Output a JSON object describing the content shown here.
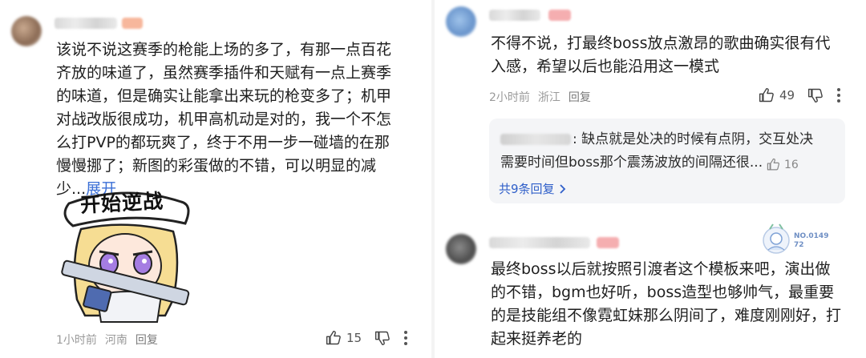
{
  "comments": [
    {
      "text": "该说不说这赛季的枪能上场的多了，有那一点百花齐放的味道了，虽然赛季插件和天赋有一点上赛季的味道，但是确实让能拿出来玩的枪变多了；机甲对战改版很成功，机甲高机动是对的，我一个不怎么打PVP的都玩爽了，终于不用一步一碰墙的在那慢慢挪了；新图的彩蛋做的不错，可以明显的减少...",
      "expand_label": "展开",
      "sticker_text": "开始逆战",
      "time": "1小时前",
      "location": "河南",
      "reply_label": "回复",
      "likes": "15"
    },
    {
      "text": "不得不说，打最终boss放点激昂的歌曲确实很有代入感，希望以后也能沿用这一模式",
      "time": "2小时前",
      "location": "浙江",
      "reply_label": "回复",
      "likes": "49",
      "sub_reply": {
        "text": ": 缺点就是处决的时候有点阴，交互处决需要时间但boss那个震荡波放的间隔还很...",
        "likes": "16"
      },
      "more_replies_label": "共9条回复"
    },
    {
      "text": "最终boss以后就按照引渡者这个模板来吧，演出做的不错，bgm也好听，boss造型也够帅气，最重要的是技能组不像霓虹妹那么阴间了，难度刚刚好，打起来挺养老的",
      "badge_text": "NO.014972"
    }
  ]
}
